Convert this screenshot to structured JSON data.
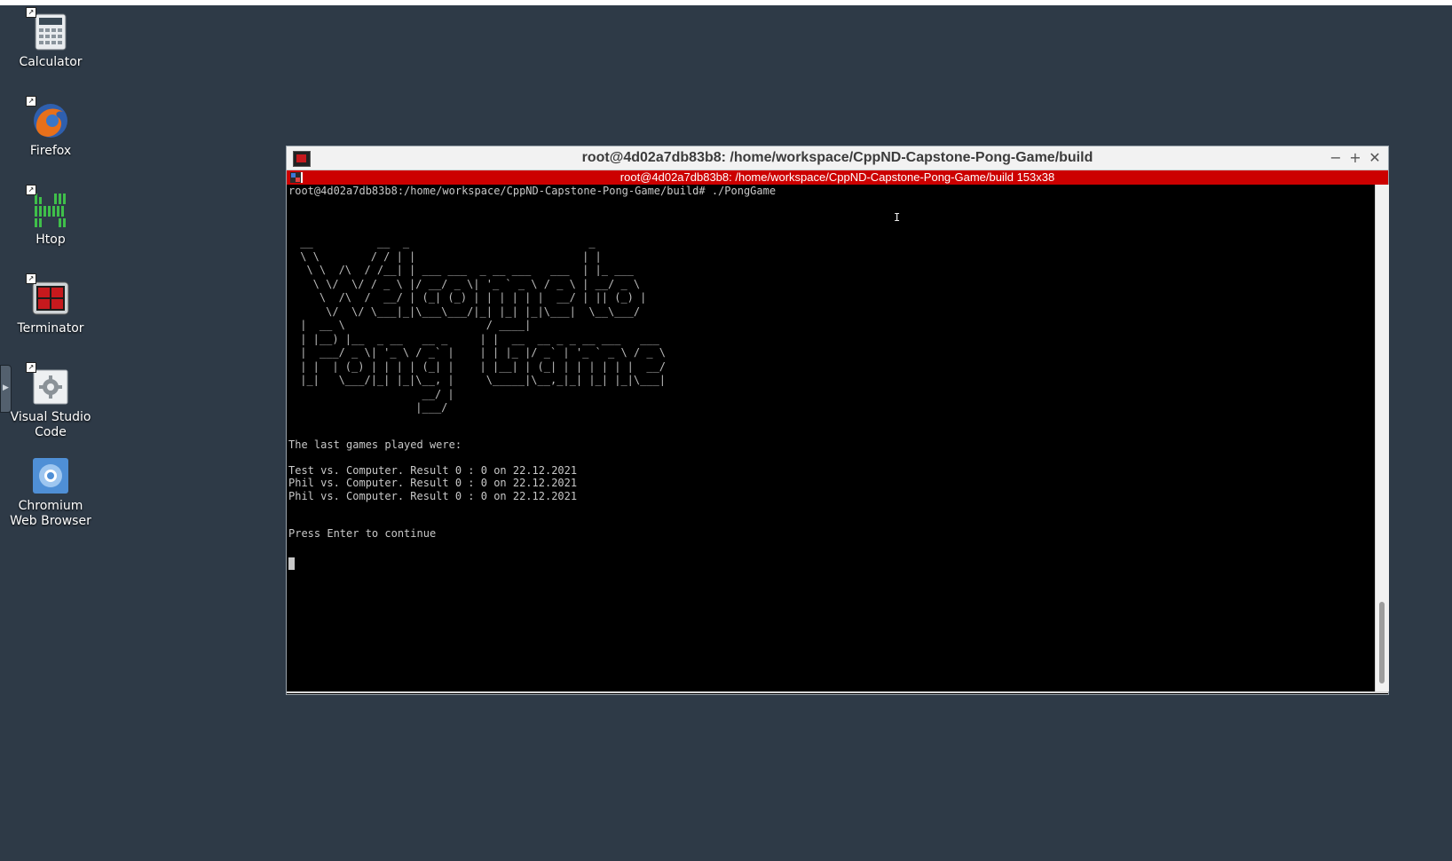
{
  "desktop": {
    "icons": [
      {
        "label": "Calculator",
        "icon": "calculator-icon"
      },
      {
        "label": "Firefox",
        "icon": "firefox-icon"
      },
      {
        "label": "Htop",
        "icon": "htop-icon"
      },
      {
        "label": "Terminator",
        "icon": "terminator-icon"
      },
      {
        "label": "Visual Studio Code",
        "icon": "vscode-icon"
      },
      {
        "label": "Chromium Web Browser",
        "icon": "chromium-icon"
      }
    ],
    "background_color": "#2e3a47"
  },
  "window": {
    "title": "root@4d02a7db83b8: /home/workspace/CppND-Capstone-Pong-Game/build",
    "controls": {
      "minimize": "−",
      "maximize": "+",
      "close": "✕"
    },
    "terminal_header": "root@4d02a7db83b8: /home/workspace/CppND-Capstone-Pong-Game/build 153x38",
    "header_color": "#cc0000"
  },
  "terminal": {
    "prompt_line": "root@4d02a7db83b8:/home/workspace/CppND-Capstone-Pong-Game/build# ./PongGame",
    "ascii_banner": " __          __  _                            _        \n \\ \\        / / | |                          | |       \n  \\ \\  /\\  / /__| | ___ ___  _ __ ___   ___  | |_ ___  \n   \\ \\/  \\/ / _ \\ |/ __/ _ \\| '_ ` _ \\ / _ \\ | __/ _ \\ \n    \\  /\\  /  __/ | (_| (_) | | | | | |  __/ | || (_) |\n     \\/  \\/ \\___|_|\\___\\___/|_| |_| |_|\\___|  \\__\\___/ \n |  __ \\                      / ____|                   \n | |__) |__  _ __   __ _     | |  __  __ _ _ __ ___   ___ \n |  ___/ _ \\| '_ \\ / _` |    | | |_ |/ _` | '_ ` _ \\ / _ \\\n | |  | (_) | | | | (_| |    | |__| | (_| | | | | | |  __/\n |_|   \\___/|_| |_|\\__, |     \\_____|\\__,_|_| |_| |_|\\___|\n                    __/ |                                \n                   |___/                                 ",
    "history_heading": "The last games played were:",
    "history": [
      "Test vs. Computer. Result 0 : 0 on 22.12.2021",
      "Phil vs. Computer. Result 0 : 0 on 22.12.2021",
      "Phil vs. Computer. Result 0 : 0 on 22.12.2021"
    ],
    "continue_prompt": "Press Enter to continue",
    "text_color": "#c8c8c8"
  }
}
